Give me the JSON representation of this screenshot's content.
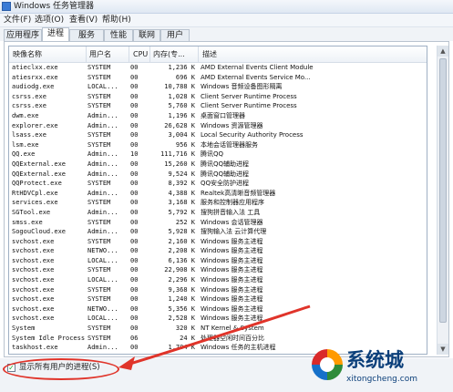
{
  "window": {
    "title": "Windows 任务管理器"
  },
  "menu": [
    {
      "label": "文件(F)"
    },
    {
      "label": "选项(O)"
    },
    {
      "label": "查看(V)"
    },
    {
      "label": "帮助(H)"
    }
  ],
  "tabs": [
    {
      "label": "应用程序"
    },
    {
      "label": "进程",
      "active": true
    },
    {
      "label": "服务"
    },
    {
      "label": "性能"
    },
    {
      "label": "联网"
    },
    {
      "label": "用户"
    }
  ],
  "columns": {
    "name": "映像名称",
    "user": "用户名",
    "cpu": "CPU",
    "mem": "内存(专...",
    "desc": "描述"
  },
  "rows": [
    [
      "atieclxx.exe",
      "SYSTEM",
      "00",
      "1,236 K",
      "AMD External Events Client Module"
    ],
    [
      "atiesrxx.exe",
      "SYSTEM",
      "00",
      "696 K",
      "AMD External Events Service Mo..."
    ],
    [
      "audiodg.exe",
      "LOCAL...",
      "00",
      "10,788 K",
      "Windows 音频设备图形隔离"
    ],
    [
      "csrss.exe",
      "SYSTEM",
      "00",
      "1,028 K",
      "Client Server Runtime Process"
    ],
    [
      "csrss.exe",
      "SYSTEM",
      "00",
      "5,760 K",
      "Client Server Runtime Process"
    ],
    [
      "dwm.exe",
      "Admin...",
      "00",
      "1,196 K",
      "桌面窗口管理器"
    ],
    [
      "explorer.exe",
      "Admin...",
      "00",
      "26,628 K",
      "Windows 资源管理器"
    ],
    [
      "lsass.exe",
      "SYSTEM",
      "00",
      "3,004 K",
      "Local Security Authority Process"
    ],
    [
      "lsm.exe",
      "SYSTEM",
      "00",
      "956 K",
      "本地会话管理器服务"
    ],
    [
      "QQ.exe",
      "Admin...",
      "10",
      "111,716 K",
      "腾讯QQ"
    ],
    [
      "QQExternal.exe",
      "Admin...",
      "00",
      "15,260 K",
      "腾讯QQ辅助进程"
    ],
    [
      "QQExternal.exe",
      "Admin...",
      "00",
      "9,524 K",
      "腾讯QQ辅助进程"
    ],
    [
      "QQProtect.exe",
      "SYSTEM",
      "00",
      "8,392 K",
      "QQ安全防护进程"
    ],
    [
      "RtHDVCpl.exe",
      "Admin...",
      "00",
      "4,388 K",
      "Realtek高清晰音频管理器"
    ],
    [
      "services.exe",
      "SYSTEM",
      "00",
      "3,168 K",
      "服务和控制器应用程序"
    ],
    [
      "SGTool.exe",
      "Admin...",
      "00",
      "5,792 K",
      "搜狗拼音输入法 工具"
    ],
    [
      "smss.exe",
      "SYSTEM",
      "00",
      "252 K",
      "Windows 会话管理器"
    ],
    [
      "SogouCloud.exe",
      "Admin...",
      "00",
      "5,928 K",
      "搜狗输入法 云计算代理"
    ],
    [
      "svchost.exe",
      "SYSTEM",
      "00",
      "2,160 K",
      "Windows 服务主进程"
    ],
    [
      "svchost.exe",
      "NETWO...",
      "00",
      "2,208 K",
      "Windows 服务主进程"
    ],
    [
      "svchost.exe",
      "LOCAL...",
      "00",
      "6,136 K",
      "Windows 服务主进程"
    ],
    [
      "svchost.exe",
      "SYSTEM",
      "00",
      "22,908 K",
      "Windows 服务主进程"
    ],
    [
      "svchost.exe",
      "LOCAL...",
      "00",
      "2,296 K",
      "Windows 服务主进程"
    ],
    [
      "svchost.exe",
      "SYSTEM",
      "00",
      "9,368 K",
      "Windows 服务主进程"
    ],
    [
      "svchost.exe",
      "SYSTEM",
      "00",
      "1,240 K",
      "Windows 服务主进程"
    ],
    [
      "svchost.exe",
      "NETWO...",
      "00",
      "5,356 K",
      "Windows 服务主进程"
    ],
    [
      "svchost.exe",
      "LOCAL...",
      "00",
      "2,528 K",
      "Windows 服务主进程"
    ],
    [
      "System",
      "SYSTEM",
      "00",
      "320 K",
      "NT Kernel & System"
    ],
    [
      "System Idle Process",
      "SYSTEM",
      "06",
      "24 K",
      "处理器空闲时间百分比"
    ],
    [
      "taskhost.exe",
      "Admin...",
      "00",
      "1,704 K",
      "Windows 任务的主机进程"
    ]
  ],
  "show_all_checkbox": {
    "label": "显示所有用户的进程(S)",
    "checked": true
  },
  "watermark": {
    "text": "系统城",
    "url": "xitongcheng.com"
  },
  "colors": {
    "annotation": "#e0342a"
  }
}
